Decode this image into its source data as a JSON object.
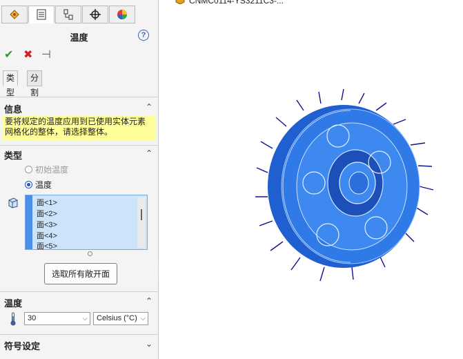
{
  "tabs": [
    {
      "name": "feature-manager",
      "icon": "feature-manager-icon"
    },
    {
      "name": "property-manager",
      "icon": "property-manager-icon"
    },
    {
      "name": "configuration-manager",
      "icon": "configuration-manager-icon"
    },
    {
      "name": "dimxpert-manager",
      "icon": "crosshair-icon"
    },
    {
      "name": "display-manager",
      "icon": "appearance-icon"
    }
  ],
  "header": {
    "title": "温度",
    "help": "?"
  },
  "actions": {
    "ok_icon": "check-icon",
    "cancel_icon": "close-icon",
    "pin_icon": "pin-icon"
  },
  "subtabs": [
    {
      "label": "类型"
    },
    {
      "label": "分割"
    }
  ],
  "info": {
    "heading": "信息",
    "message": "要将规定的温度应用到已使用实体元素网格化的整体，请选择整体。"
  },
  "type": {
    "heading": "类型",
    "options": [
      {
        "label": "初始温度",
        "selected": false,
        "disabled": true
      },
      {
        "label": "温度",
        "selected": true,
        "disabled": false
      }
    ],
    "faces": [
      "面<1>",
      "面<2>",
      "面<3>",
      "面<4>",
      "面<5>"
    ],
    "select_button": "选取所有敞开面"
  },
  "temperature": {
    "heading": "温度",
    "value": "30",
    "unit": "Celsius (°C)"
  },
  "symbol": {
    "heading": "符号设定"
  },
  "viewport": {
    "document_title": "CNMC0114-YS3211C3-..."
  },
  "colors": {
    "accent": "#1a56c8",
    "info_bg": "#ffff99",
    "model": "#2f7ae6",
    "arrows": "#10108c"
  }
}
